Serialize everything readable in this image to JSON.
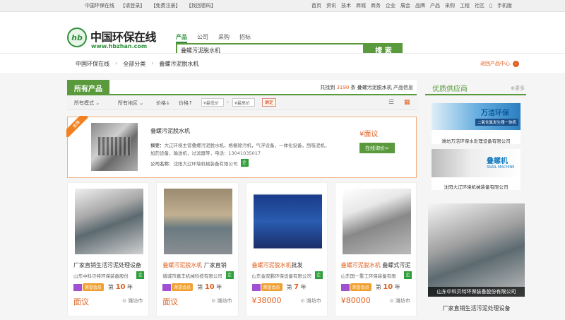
{
  "topbar": {
    "left": [
      "中国环保在线",
      "【请登录】",
      "【免费注册】",
      "【找回密码】"
    ],
    "nav": [
      "首页",
      "资讯",
      "技术",
      "商城",
      "商务",
      "企业",
      "展会",
      "品牌",
      "产品",
      "采购",
      "工程",
      "社区",
      "手机版"
    ]
  },
  "logo": {
    "name": "中国环保在线",
    "url": "www.hbzhan.com"
  },
  "search": {
    "tabs": [
      "产品",
      "公司",
      "采购",
      "招标"
    ],
    "value": "叠螺污泥脱水机",
    "button": "搜 索"
  },
  "breadcrumb": {
    "items": [
      "中国环保在线",
      "全部分类",
      "叠螺污泥脱水机"
    ],
    "right": "返回产品中心"
  },
  "results": {
    "tab": "所有产品",
    "found_prefix": "共找到",
    "count": "3190",
    "found_mid": "条",
    "keyword": "叠螺污泥脱水机",
    "found_suffix": "产品信息"
  },
  "filters": {
    "mode": "所有模式",
    "area": "所有地区",
    "price_sort1": "价格",
    "price_sort2": "价格",
    "low_ph": "¥最低价",
    "dash": "-",
    "high_ph": "¥最高价",
    "ok": "确定"
  },
  "featured": {
    "ribbon": "金牌",
    "title": "叠螺污泥脱水机",
    "desc_label": "摘要：",
    "desc": "大辽环境主营叠螺污泥脱水机，格栅除污机，气浮设备，一体化设备，刮吸泥机，加药设备，输送机，过滤器等，电话：13041035017",
    "co_label": "公司名称：",
    "company": "沈阳大辽环境机械装备有限公司",
    "cert": "企",
    "price": "¥面议",
    "button": "在线询价>"
  },
  "cards": [
    {
      "title_hl": "",
      "title": "厂家直销生活污泥处理设备",
      "company": "山东中科贝特环保装备股份",
      "cert": "企",
      "years": "10",
      "price": "面议",
      "loc": "潍坊市"
    },
    {
      "title_hl": "叠螺污泥脱水机",
      "title": " 厂家直销",
      "company": "诸城市嘉丰机械科技有限公司",
      "cert": "企",
      "years": "10",
      "price": "面议",
      "loc": "潍坊市"
    },
    {
      "title_hl": "叠螺污泥脱水机",
      "title": "批发",
      "company": "山东金双鹏环保设备有限公司",
      "cert": "企",
      "years": "7",
      "price": "¥38000",
      "loc": "潍坊市"
    },
    {
      "title_hl": "叠螺污泥脱水机",
      "title": " 叠螺式污泥",
      "company": "山东国一重工环保装备有限",
      "cert": "企",
      "years": "10",
      "price": "¥80000",
      "loc": "潍坊市"
    }
  ],
  "card_common": {
    "vtag": "荣誉会员",
    "di": "第",
    "nian": "年"
  },
  "side": {
    "title": "优质供应商",
    "more": "更多",
    "sup1": {
      "brand": "万洁环保",
      "slogan": "二氧化氯发生器一体机",
      "name": "潍坊万洁环保水处理设备有限公司"
    },
    "sup2": {
      "brand": "叠螺机",
      "slogan": "SNAIL MACHINE",
      "name": "沈阳大辽环境机械装备有限公司"
    },
    "prod_caption": "山东中科贝特环保装备股份有限公司",
    "prod_title": "厂家直销生活污泥处理设备"
  }
}
